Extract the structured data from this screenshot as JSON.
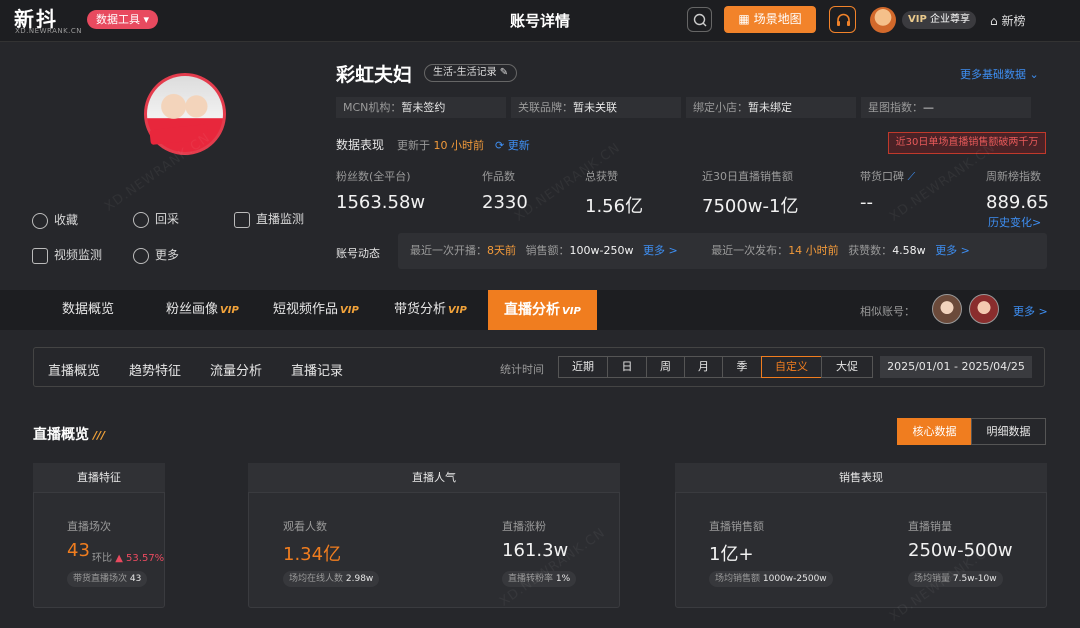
{
  "header": {
    "logo": "新抖",
    "logo_sub": "XD.NEWRANK.CN",
    "data_tools": "数据工具",
    "page_title": "账号详情",
    "scene_map": "场景地图",
    "vip_label": "VIP",
    "vip_tier": "企业尊享",
    "newrank": "新榜"
  },
  "profile": {
    "name": "彩虹夫妇",
    "category": "生活-生活记录",
    "more_basic": "更多基础数据",
    "info": [
      {
        "k": "MCN机构：",
        "v": "暂未签约"
      },
      {
        "k": "关联品牌：",
        "v": "暂未关联"
      },
      {
        "k": "绑定小店：",
        "v": "暂未绑定"
      },
      {
        "k": "星图指数：",
        "v": "—"
      }
    ],
    "actions": [
      "收藏",
      "回采",
      "直播监测",
      "视频监测",
      "更多"
    ]
  },
  "performance": {
    "label": "数据表现",
    "updated_prefix": "更新于",
    "updated_value": "10 小时前",
    "update_link": "更新",
    "alert": "近30日单场直播销售额破两千万",
    "metrics": [
      {
        "label": "粉丝数(全平台)",
        "value": "1563.58w"
      },
      {
        "label": "作品数",
        "value": "2330"
      },
      {
        "label": "总获赞",
        "value": "1.56亿"
      },
      {
        "label": "近30日直播销售额",
        "value": "7500w-1亿"
      },
      {
        "label": "带货口碑",
        "value": "--"
      },
      {
        "label": "周新榜指数",
        "value": "889.65"
      }
    ],
    "history_link": "历史变化>"
  },
  "dynamics": {
    "label": "账号动态",
    "last_live_k": "最近一次开播：",
    "last_live_v": "8天前",
    "sales_k": "销售额：",
    "sales_v": "100w-250w",
    "more1": "更多 >",
    "last_post_k": "最近一次发布：",
    "last_post_v": "14 小时前",
    "likes_k": "获赞数：",
    "likes_v": "4.58w",
    "more2": "更多 >"
  },
  "tabs": {
    "items": [
      "数据概览",
      "粉丝画像",
      "短视频作品",
      "带货分析",
      "直播分析"
    ],
    "vip": "VIP",
    "similar_label": "相似账号：",
    "similar_more": "更多 >"
  },
  "subnav": {
    "items": [
      "直播概览",
      "趋势特征",
      "流量分析",
      "直播记录"
    ],
    "stat_time": "统计时间",
    "ranges": [
      "近期",
      "日",
      "周",
      "月",
      "季",
      "自定义",
      "大促"
    ],
    "date_range": "2025/01/01 - 2025/04/25"
  },
  "overview": {
    "title": "直播概览",
    "core_data": "核心数据",
    "detail_data": "明细数据",
    "feature": {
      "head": "直播特征",
      "label": "直播场次",
      "value": "43",
      "hb_label": "环比",
      "hb_value": "▲ 53.57%",
      "sub_k": "带货直播场次",
      "sub_v": "43"
    },
    "popularity": {
      "head": "直播人气",
      "viewers_label": "观看人数",
      "viewers_value": "1.34亿",
      "viewers_sub_k": "场均在线人数",
      "viewers_sub_v": "2.98w",
      "fans_label": "直播涨粉",
      "fans_value": "161.3w",
      "fans_sub_k": "直播转粉率",
      "fans_sub_v": "1%"
    },
    "sales": {
      "head": "销售表现",
      "amount_label": "直播销售额",
      "amount_value": "1亿+",
      "amount_sub_k": "场均销售额",
      "amount_sub_v": "1000w-2500w",
      "volume_label": "直播销量",
      "volume_value": "250w-500w",
      "volume_sub_k": "场均销量",
      "volume_sub_v": "7.5w-10w"
    }
  },
  "colors": {
    "accent": "#f07d1f",
    "link": "#3e8ff3",
    "background": "#26272b"
  }
}
